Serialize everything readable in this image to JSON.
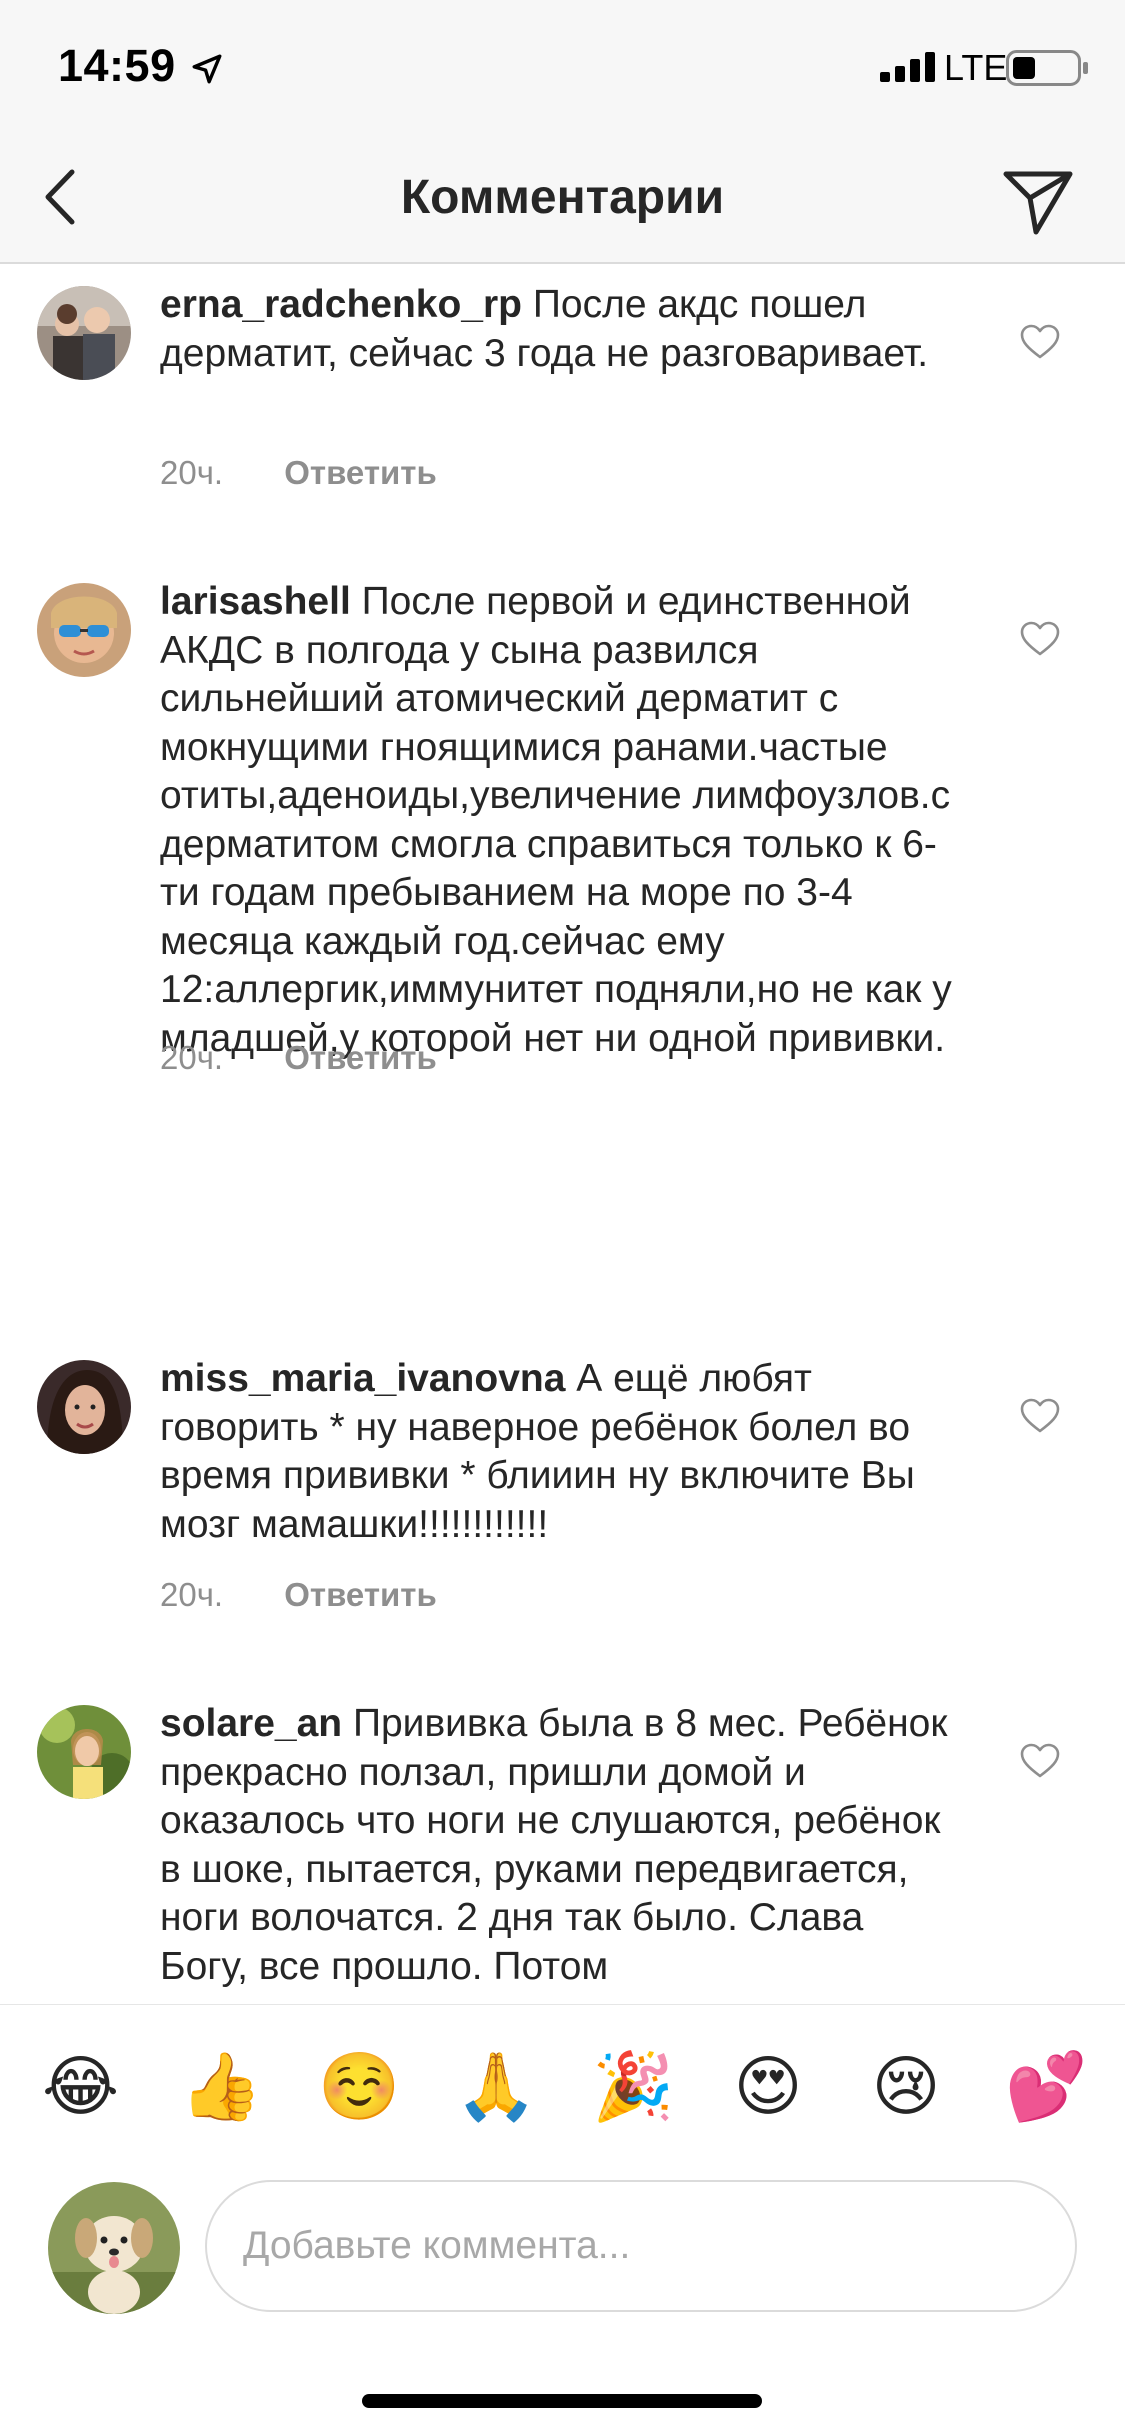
{
  "status_bar": {
    "time": "14:59",
    "network": "LTE"
  },
  "header": {
    "title": "Комментарии"
  },
  "comments": [
    {
      "username": "erna_radchenko_rp",
      "text": "После акдс пошел дерматит, сейчас 3 года не разговаривает.",
      "time": "20ч.",
      "reply_label": "Ответить"
    },
    {
      "username": "larisashell",
      "text": "После первой и единственной АКДС в полгода у сына развился сильнейший атомический дерматит с мокнущими гноящимися ранами.частые отиты,аденоиды,увеличение лимфоузлов.с дерматитом смогла справиться только к 6-ти годам пребыванием на море по 3-4 месяца каждый год.сейчас ему 12:аллергик,иммунитет подняли,но не как у младшей,у которой нет ни одной прививки.",
      "time": "20ч.",
      "reply_label": "Ответить"
    },
    {
      "username": "miss_maria_ivanovna",
      "text": "А ещё любят говорить * ну наверное ребёнок болел во время прививки * блииин ну включите Вы мозг мамашки!!!!!!!!!!!!",
      "time": "20ч.",
      "reply_label": "Ответить"
    },
    {
      "username": "solare_an",
      "text": "Прививка была в 8 мес. Ребёнок прекрасно ползал, пришли домой и  оказалось что ноги не слушаются, ребёнок в шоке, пытается, руками передвигается, ноги волочатся. 2 дня так было. Слава Богу, все прошло. Потом",
      "time": "",
      "reply_label": ""
    }
  ],
  "emoji_bar": [
    "😂",
    "👍",
    "☺️",
    "🙏",
    "🎉",
    "😍",
    "😢",
    "💕"
  ],
  "composer": {
    "placeholder": "Добавьте коммента..."
  },
  "colors": {
    "text": "#262626",
    "secondary": "#8e8e8e",
    "divider": "#dbdbdb",
    "bar_bg": "#f7f7f7"
  }
}
